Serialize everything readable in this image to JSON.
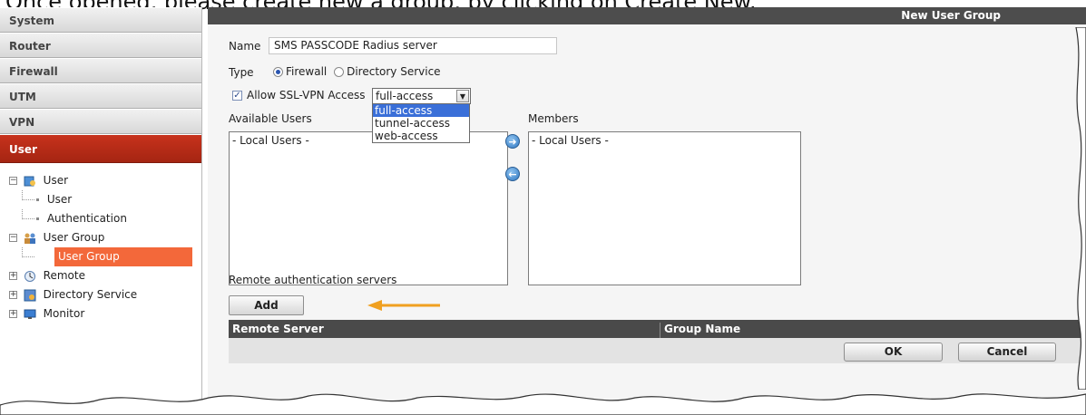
{
  "caption": "Once opened, please create new a group, by clicking on Create New.",
  "sidebar": {
    "sections": [
      "System",
      "Router",
      "Firewall",
      "UTM",
      "VPN"
    ],
    "active_section": "User",
    "tree": {
      "user": {
        "label": "User",
        "children": [
          "User",
          "Authentication"
        ]
      },
      "user_group": {
        "label": "User Group",
        "children": [
          "User Group"
        ]
      },
      "remote": {
        "label": "Remote"
      },
      "directory_service": {
        "label": "Directory Service"
      },
      "monitor": {
        "label": "Monitor"
      }
    }
  },
  "main": {
    "title": "New User Group",
    "name_label": "Name",
    "name_value": "SMS PASSCODE Radius server",
    "type_label": "Type",
    "type_options": [
      "Firewall",
      "Directory Service"
    ],
    "type_selected": "Firewall",
    "ssl_vpn_label": "Allow SSL-VPN Access",
    "ssl_vpn_checked": true,
    "ssl_vpn_value": "full-access",
    "ssl_vpn_options": [
      "full-access",
      "tunnel-access",
      "web-access"
    ],
    "available_users_label": "Available Users",
    "available_users_items": [
      "- Local Users -"
    ],
    "members_label": "Members",
    "members_items": [
      "- Local Users -"
    ],
    "remote_auth_label": "Remote authentication servers",
    "add_button": "Add",
    "table_columns": [
      "Remote Server",
      "Group Name"
    ],
    "ok_button": "OK",
    "cancel_button": "Cancel"
  },
  "colors": {
    "active_section": "#b12c17",
    "selected_leaf": "#f3683a",
    "title_bar": "#4d4d4d",
    "dropdown_highlight": "#3a6fd8",
    "annotation_arrow": "#f0a020"
  }
}
